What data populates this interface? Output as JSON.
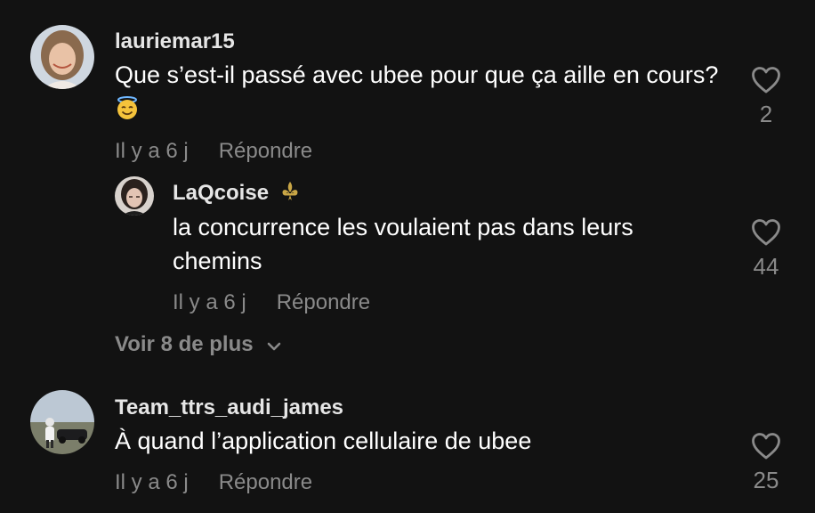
{
  "comments": [
    {
      "username": "lauriemar15",
      "text": "Que s’est-il passé avec ubee pour que ça aille en cours?",
      "emoji": "smiling-face-with-halo",
      "time": "Il y a 6 j",
      "reply_label": "Répondre",
      "likes": "2"
    },
    {
      "username": "Team_ttrs_audi_james",
      "text": "À quand l’application cellulaire de ubee",
      "time": "Il y a 6 j",
      "reply_label": "Répondre",
      "likes": "25"
    }
  ],
  "reply": {
    "username": "LaQcoise",
    "badge_icon": "fleur-de-lis-icon",
    "text": "la concurrence les voulaient pas dans leurs chemins",
    "time": "Il y a 6 j",
    "reply_label": "Répondre",
    "likes": "44"
  },
  "view_more_label": "Voir 8 de plus",
  "colors": {
    "background": "#121212",
    "primary_text": "#ffffff",
    "secondary_text": "#8a8a8a",
    "heart_outline": "#8a8a8a"
  }
}
